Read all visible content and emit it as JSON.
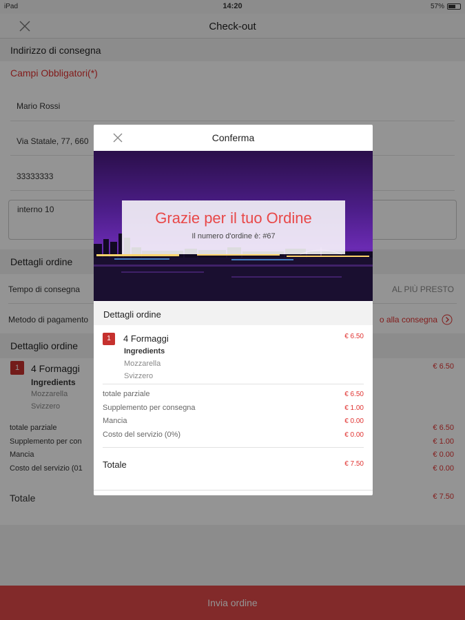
{
  "status_bar": {
    "device": "iPad",
    "time": "14:20",
    "battery": "57%"
  },
  "nav": {
    "title": "Check-out"
  },
  "address": {
    "header": "Indirizzo di consegna",
    "required_note": "Campi Obbligatori(*)",
    "name": "Mario Rossi",
    "street": "Via Statale, 77, 660",
    "phone": "33333333",
    "notes": "interno 10"
  },
  "order_details": {
    "header": "Dettagli ordine",
    "delivery_time_label": "Tempo di consegna",
    "delivery_time_value": "AL PIÙ PRESTO",
    "payment_label": "Metodo di pagamento",
    "payment_value": "o alla consegna"
  },
  "order_detail": {
    "header": "Dettaglio ordine",
    "item": {
      "qty": "1",
      "name": "4 Formaggi",
      "ingredients_label": "Ingredients",
      "ingredients": [
        "Mozzarella",
        "Svizzero"
      ],
      "price": "€ 6.50"
    },
    "subtotal_label": "totale parziale",
    "subtotal": "€ 6.50",
    "delivery_label": "Supplemento per con",
    "delivery": "€ 1.00",
    "tip_label": "Mancia",
    "tip": "€ 0.00",
    "service_label": "Costo del servizio (01",
    "service": "€ 0.00",
    "total_label": "Totale",
    "total": "€ 7.50"
  },
  "submit": {
    "label": "Invia ordine"
  },
  "modal": {
    "title": "Conferma",
    "thanks": "Grazie per il tuo Ordine",
    "order_number": "Il numero d'ordine è: #67",
    "section": "Dettagli ordine",
    "item": {
      "qty": "1",
      "name": "4 Formaggi",
      "ingredients_label": "Ingredients",
      "ingredients": [
        "Mozzarella",
        "Svizzero"
      ],
      "price": "€ 6.50"
    },
    "subtotal_label": "totale parziale",
    "subtotal": "€ 6.50",
    "delivery_label": "Supplemento per consegna",
    "delivery": "€ 1.00",
    "tip_label": "Mancia",
    "tip": "€ 0.00",
    "service_label": "Costo del servizio (0%)",
    "service": "€ 0.00",
    "total_label": "Totale",
    "total": "€ 7.50"
  },
  "colors": {
    "accent": "#e0312f",
    "button": "#e04949",
    "qty_badge": "#c6312e"
  }
}
